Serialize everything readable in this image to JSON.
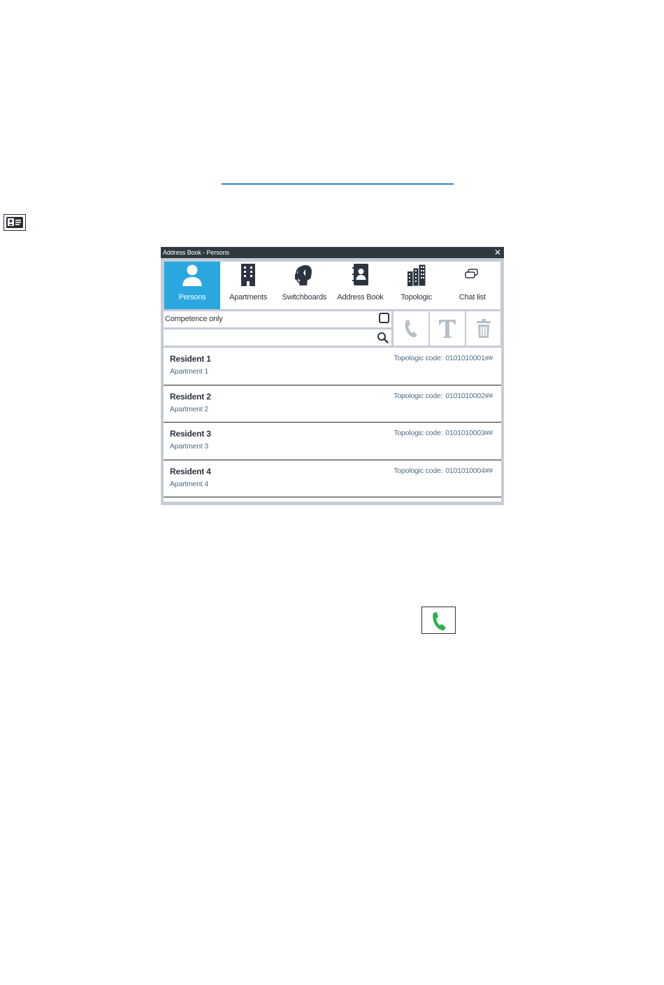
{
  "window": {
    "title": "Address Book - Persons",
    "close_label": "✕"
  },
  "tabs": [
    {
      "label": "Persons",
      "icon": "person-icon",
      "active": true
    },
    {
      "label": "Apartments",
      "icon": "building-icon",
      "active": false
    },
    {
      "label": "Switchboards",
      "icon": "headset-operator-icon",
      "active": false
    },
    {
      "label": "Address Book",
      "icon": "contact-book-icon",
      "active": false
    },
    {
      "label": "Topologic",
      "icon": "buildings-icon",
      "active": false
    },
    {
      "label": "Chat list",
      "icon": "chat-bubbles-icon",
      "active": false
    }
  ],
  "filters": {
    "competence_label": "Competence only",
    "competence_checked": false,
    "search_value": "",
    "search_placeholder": ""
  },
  "actions": {
    "call_icon": "phone-icon",
    "text_icon": "text-icon",
    "delete_icon": "trash-icon"
  },
  "list": {
    "topologic_label": "Topologic code:",
    "rows": [
      {
        "name": "Resident 1",
        "apartment": "Apartment 1",
        "code": "0101010001##"
      },
      {
        "name": "Resident 2",
        "apartment": "Apartment 2",
        "code": "0101010002##"
      },
      {
        "name": "Resident 3",
        "apartment": "Apartment 3",
        "code": "0101010003##"
      },
      {
        "name": "Resident 4",
        "apartment": "Apartment 4",
        "code": "0101010004##"
      }
    ]
  },
  "colors": {
    "accent": "#29a8e0",
    "titlebar": "#2f3a40",
    "call_green": "#2db04b",
    "rule_blue": "#2e86c6"
  }
}
